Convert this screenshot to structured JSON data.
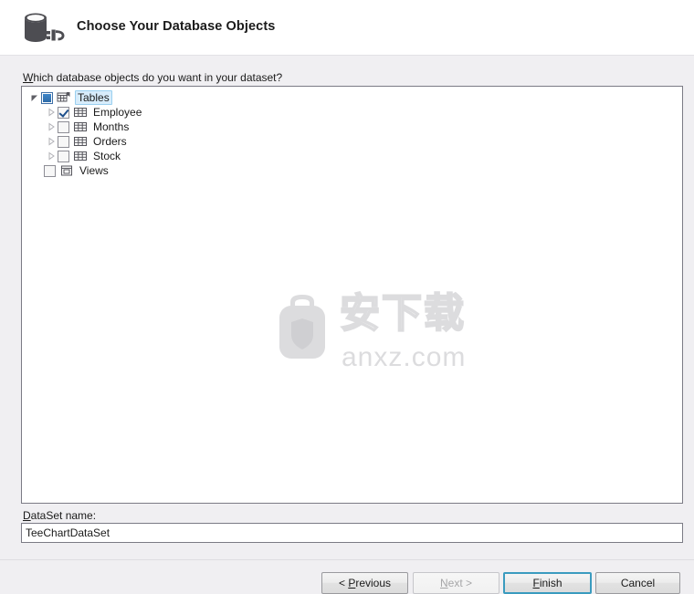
{
  "window": {
    "title": "Choose Your Database Objects",
    "header_icon": "database-plug-icon"
  },
  "main": {
    "prompt": {
      "accelerator": "W",
      "rest": "hich database objects do you want in your dataset?"
    },
    "tree": {
      "nodes": [
        {
          "label": "Tables",
          "icon": "tables-folder-icon",
          "checkbox": "indeterminate",
          "expander": "expanded",
          "selected": true,
          "level": 0,
          "children": [
            {
              "label": "Employee",
              "icon": "table-grid-icon",
              "checkbox": "checked",
              "expander": "collapsed",
              "selected": false,
              "level": 1
            },
            {
              "label": "Months",
              "icon": "table-grid-icon",
              "checkbox": "unchecked",
              "expander": "collapsed",
              "selected": false,
              "level": 1
            },
            {
              "label": "Orders",
              "icon": "table-grid-icon",
              "checkbox": "unchecked",
              "expander": "collapsed",
              "selected": false,
              "level": 1
            },
            {
              "label": "Stock",
              "icon": "table-grid-icon",
              "checkbox": "unchecked",
              "expander": "collapsed",
              "selected": false,
              "level": 1
            }
          ]
        },
        {
          "label": "Views",
          "icon": "views-window-icon",
          "checkbox": "unchecked",
          "expander": "none",
          "selected": false,
          "level": 0,
          "children": []
        }
      ]
    },
    "watermark": {
      "cn_text": "安下载",
      "domain_text": "anxz.com",
      "badge_char": "安"
    }
  },
  "dataset": {
    "label_accelerator": "D",
    "label_rest": "ataSet name:",
    "value": "TeeChartDataSet",
    "placeholder": ""
  },
  "footer": {
    "buttons": [
      {
        "name": "previous",
        "prefix": "< ",
        "accelerator": "P",
        "suffix": "revious",
        "state": "enabled"
      },
      {
        "name": "next",
        "prefix": "",
        "accelerator": "N",
        "suffix": "ext >",
        "state": "disabled"
      },
      {
        "name": "finish",
        "prefix": "",
        "accelerator": "F",
        "suffix": "inish",
        "state": "default"
      },
      {
        "name": "cancel",
        "prefix": "",
        "accelerator": "",
        "suffix": "Cancel",
        "state": "enabled"
      }
    ]
  },
  "colors": {
    "header_bg": "#ffffff",
    "body_bg": "#f0eff2",
    "panel_bg": "#ffffff",
    "panel_border": "#7b7b85",
    "selection_bg": "#d7ecfb",
    "focus_border": "#3a9bbf",
    "icon_dark": "#4d4d52",
    "watermark": "#dcdcde"
  }
}
